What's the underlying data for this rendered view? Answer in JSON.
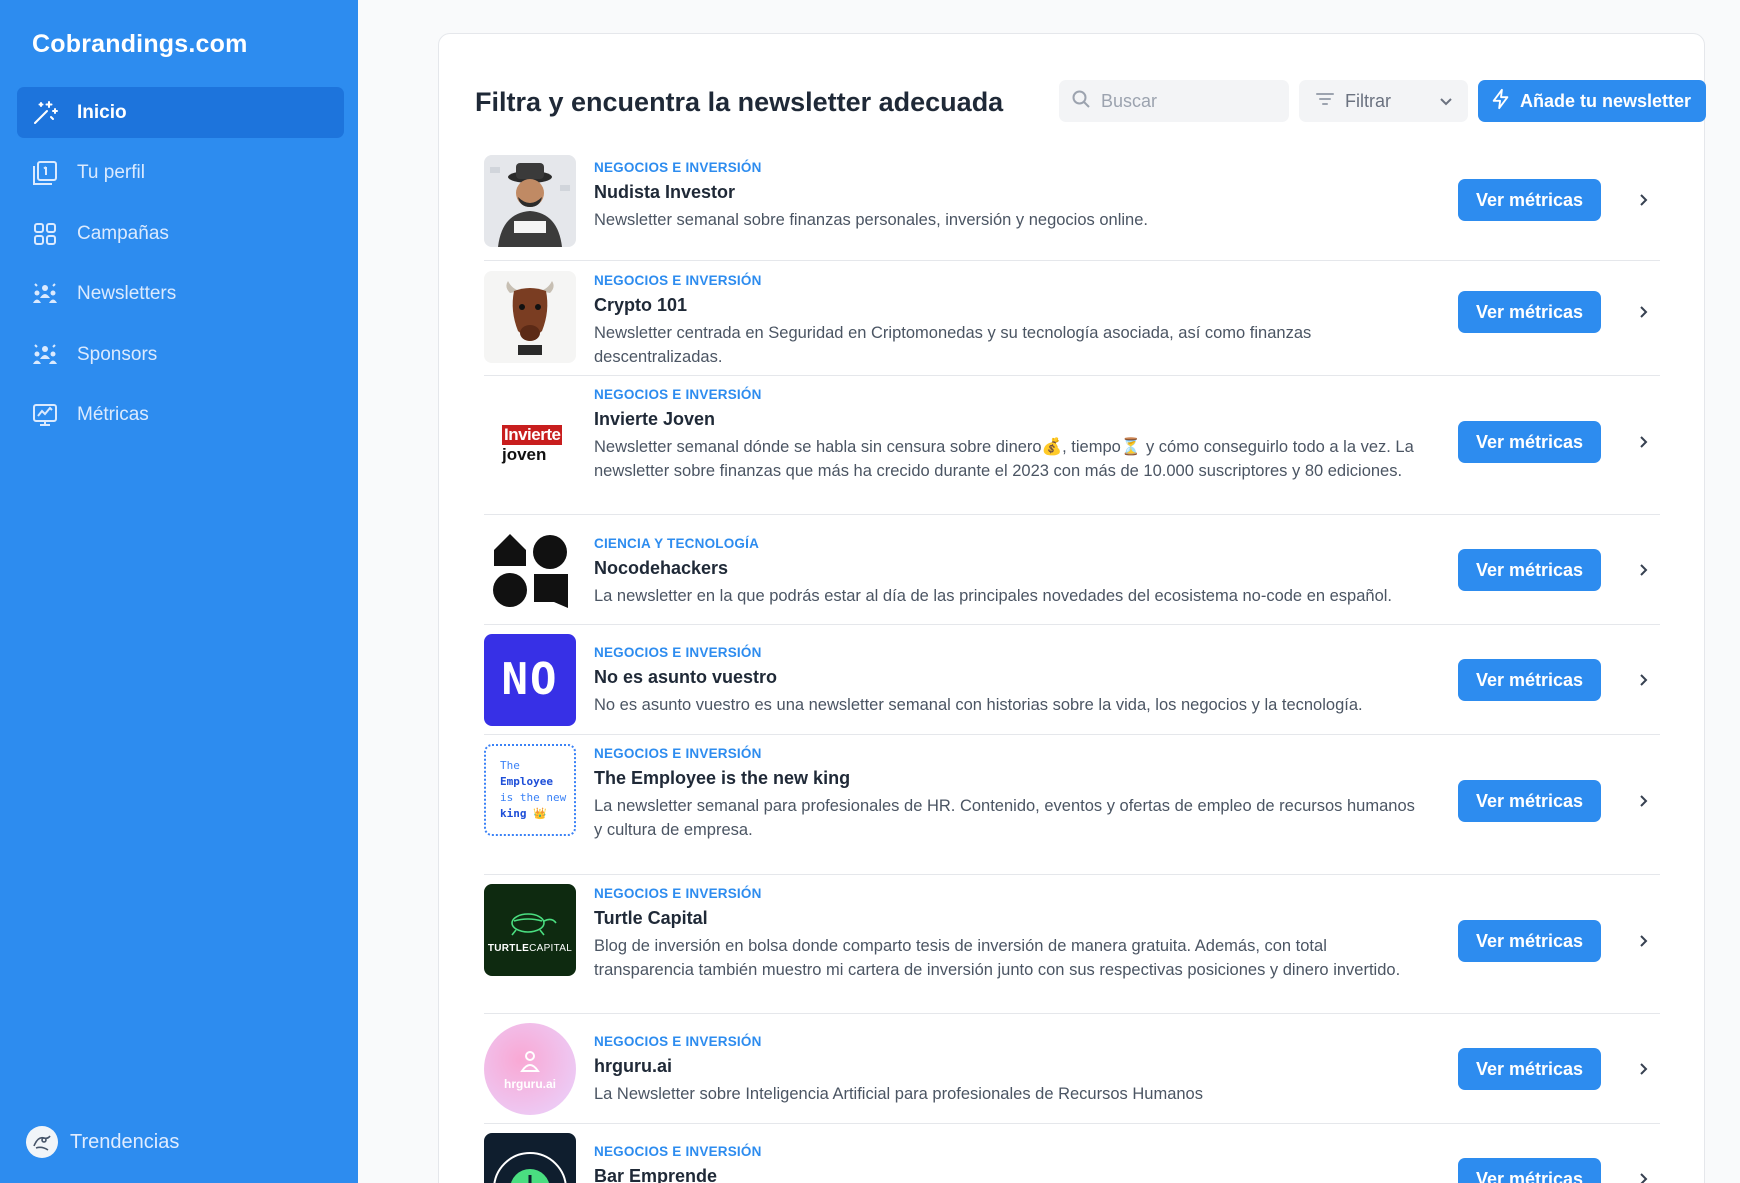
{
  "sidebar": {
    "brand": "Cobrandings.com",
    "items": [
      {
        "label": "Inicio",
        "icon": "sparkles-icon",
        "active": true
      },
      {
        "label": "Tu perfil",
        "icon": "profile-card-icon",
        "active": false
      },
      {
        "label": "Campañas",
        "icon": "grid-icon",
        "active": false
      },
      {
        "label": "Newsletters",
        "icon": "people-group-icon",
        "active": false
      },
      {
        "label": "Sponsors",
        "icon": "people-group-icon",
        "active": false
      },
      {
        "label": "Métricas",
        "icon": "monitor-chart-icon",
        "active": false
      }
    ],
    "footer_label": "Trendencias"
  },
  "header": {
    "title": "Filtra y encuentra la newsletter adecuada",
    "search_placeholder": "Buscar",
    "filter_label": "Filtrar",
    "add_button": "Añade tu newsletter"
  },
  "rows": [
    {
      "category": "NEGOCIOS E INVERSIÓN",
      "name": "Nudista Investor",
      "desc": "Newsletter semanal sobre finanzas personales, inversión y negocios online.",
      "button": "Ver métricas"
    },
    {
      "category": "NEGOCIOS E INVERSIÓN",
      "name": "Crypto 101",
      "desc": "Newsletter centrada en Seguridad en Criptomonedas y su tecnología asociada, así como finanzas descentralizadas.",
      "button": "Ver métricas"
    },
    {
      "category": "NEGOCIOS E INVERSIÓN",
      "name": "Invierte Joven",
      "desc": "Newsletter semanal dónde se habla sin censura sobre dinero💰, tiempo⏳ y cómo conseguirlo todo a la vez. La newsletter sobre finanzas que más ha crecido durante el 2023 con más de 10.000 suscriptores y 80 ediciones.",
      "button": "Ver métricas",
      "logo_line1": "Invierte",
      "logo_line2": "joven"
    },
    {
      "category": "CIENCIA Y TECNOLOGÍA",
      "name": "Nocodehackers",
      "desc": "La newsletter en la que podrás estar al día de las principales novedades del ecosistema no-code en español.",
      "button": "Ver métricas"
    },
    {
      "category": "NEGOCIOS E INVERSIÓN",
      "name": "No es asunto vuestro",
      "desc": "No es asunto vuestro es una newsletter semanal con historias sobre la vida, los negocios y la tecnología.",
      "button": "Ver métricas",
      "logo_text": "NO"
    },
    {
      "category": "NEGOCIOS E INVERSIÓN",
      "name": "The Employee is the new king",
      "desc": "La newsletter semanal para profesionales de HR. Contenido, eventos y ofertas de empleo de recursos humanos y cultura de empresa.",
      "button": "Ver métricas",
      "logo_lines": [
        "The",
        "Employee",
        "is the new",
        "king 👑"
      ]
    },
    {
      "category": "NEGOCIOS E INVERSIÓN",
      "name": "Turtle Capital",
      "desc": "Blog de inversión en bolsa donde comparto tesis de inversión de manera gratuita. Además, con total transparencia también muestro mi cartera de inversión junto con sus respectivas posiciones y dinero invertido.",
      "button": "Ver métricas",
      "logo_bold": "TURTLE",
      "logo_light": "CAPITAL"
    },
    {
      "category": "NEGOCIOS E INVERSIÓN",
      "name": "hrguru.ai",
      "desc": "La Newsletter sobre Inteligencia Artificial para profesionales de Recursos Humanos",
      "button": "Ver métricas",
      "logo_text": "hrguru.ai"
    },
    {
      "category": "NEGOCIOS E INVERSIÓN",
      "name": "Bar Emprende",
      "desc": "",
      "button": "Ver métricas"
    }
  ],
  "colors": {
    "accent": "#2d8cef",
    "sidebar": "#2d8cef",
    "active": "#1d74dc"
  }
}
